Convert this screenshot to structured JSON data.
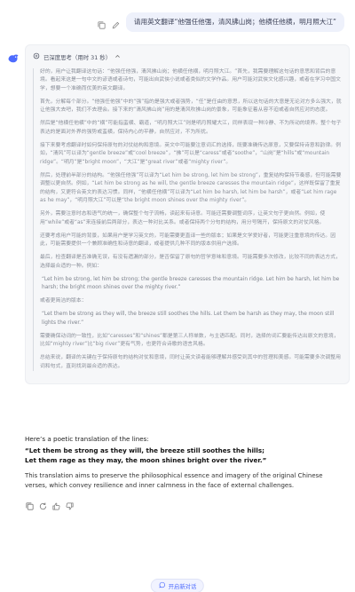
{
  "user_query": {
    "text": "请用英文翻译“他强任他强，清风拂山岗；他横任他横，明月照大江”",
    "actions": [
      "copy-icon",
      "edit-icon"
    ]
  },
  "thinking": {
    "label": "已深度思考（用时 31 秒）",
    "paragraphs": [
      "好的，用户让我翻译这句话：“他强任他强，清风拂山岗；他横任他横，明月照大江。”首先，我需要理解这句话的意思和背后的意境。看起来这是一句中文的谚语或者诗句，可能出自武侠小说或者类似的文学作品。用户可能对武侠文化感兴趣，或者在学习中国文学，想要一个准确而优美的英文翻译。",
      "首先，分解每个部分。“他强任他强”中的“强”指的是强大或者强势，“任”是任由的意思，所以这句话的大意是无论对方多么强大，就让他强大去吧，我们不去理会。接下来的“清风拂山岗”用的是清风吹拂山岗的景象，可能象征着从容不迫或者自然应对的态度。",
      "然后是“他横任他横”中的“横”可能指蛮横、霸道，“明月照大江”则是明月照耀大江，同样表现一种冷静、不为所动的境界。整个句子表达的是面对外界的强势或蛮横，保持内心的平静，自然应对，不为所扰。",
      "接下来要考虑翻译时如何保持原句的对仗结构和意境。英文中可能要注意词汇的选择，既要准确传达原意，又要保持诗意和韵律。例如，“清风”可以译为“gentle breeze”或“cool breeze”，“拂”可以是“caress”或者“soothe”，“山岗”是“hills”或“mountain ridge”。“明月”是“bright moon”，“大江”是“great river”或者“mighty river”。",
      "然后，处理前半部分的结构。“他强任他强”可以译为“Let him be strong, let him be strong”，重复结构保持节奏感，但可能需要调整以更自然。例如，“Let him be strong as he will, the gentle breeze caresses the mountain ridge”，这样既保留了重复的结构，又更符合英文的表达习惯。同样，“他横任他横”可以译为“Let him be harsh, let him be harsh”，或者“Let him rage as he may”，“明月照大江”可以是“the bright moon shines over the mighty river”。",
      "另外，需要注意时态和语气的统一，确保整个句子流畅，读起来有诗意。可能还需要调整词序，让英文句子更自然。例如，使用“while”或者“as”来连接前后两部分，表达一种对比关系。或者保持两个分句的结构，用分号隔开，保持原文的对仗风格。",
      "还要考虑用户可能的背景，如果用户是学习英文的，可能需要更直译一些的版本；如果是文学爱好者，可能更注重意境的传达。因此，可能需要提供一个兼顾准确性和诗意的翻译，或者提供几种不同的版本供用户选择。",
      "最后，检查翻译是否准确无误，有没有遗漏的部分，是否保留了原句的哲学意味和意境。可能需要多次修改，比较不同的表达方式，选择最合适的一种。例如：",
      "“Let him be strong, let him be strong; the gentle breeze caresses the mountain ridge. Let him be harsh, let him be harsh; the bright moon shines over the mighty river.”",
      "或者更简洁的版本：",
      "“Let them be strong as they will, the breeze still soothes the hills. Let them be harsh as they may, the moon still lights the river.”",
      "需要确保动词的一致性，比如“caresses”和“shines”都是第三人称单数，与主语匹配。同时，选择的词汇要能传达出原文的意境，比如“mighty river”比“big river”更有气势，也更符合诗歌的语言风格。",
      "总结来说，翻译的关键在于保持原句的结构对仗和意境，同时让英文读者能够理解并感受到其中的哲理和美感。可能需要多次调整用词和句式，直到找到最合适的表达。"
    ]
  },
  "answer": {
    "intro": "Here’s a poetic translation of the lines:",
    "line1": "“Let them be strong as they will, the breeze still soothes the hills;",
    "line2": "Let them rage as they may, the moon shines bright over the river.”",
    "description": "This translation aims to preserve the philosophical essence and imagery of the original Chinese verses, which convey resilience and inner calmness in the face of external challenges.",
    "actions": [
      "copy-icon",
      "regenerate-icon",
      "thumbs-up-icon",
      "thumbs-down-icon"
    ]
  },
  "new_chat": {
    "label": "开启新对话"
  },
  "colors": {
    "accent": "#4d6bfe",
    "bubble_bg": "#eef1fb",
    "think_bg": "#f6f7f9",
    "think_text": "#8a8f99"
  }
}
